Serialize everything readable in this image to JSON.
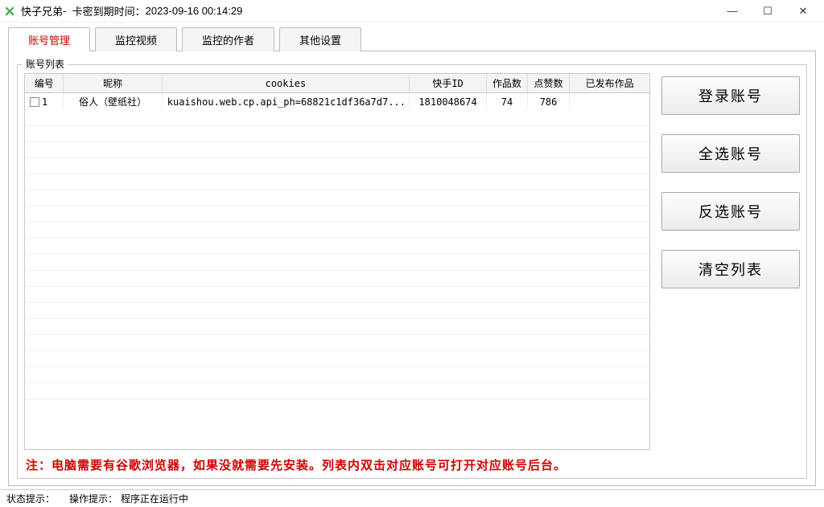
{
  "title": {
    "app_name": "快子兄弟",
    "separator": " - ",
    "expiry_label": "卡密到期时间：",
    "expiry_value": "2023-09-16 00:14:29"
  },
  "window_controls": {
    "minimize": "—",
    "maximize": "☐",
    "close": "✕"
  },
  "tabs": [
    {
      "label": "账号管理",
      "active": true
    },
    {
      "label": "监控视频",
      "active": false
    },
    {
      "label": "监控的作者",
      "active": false
    },
    {
      "label": "其他设置",
      "active": false
    }
  ],
  "panel": {
    "title": "账号列表"
  },
  "table": {
    "headers": {
      "id": "编号",
      "nickname": "昵称",
      "cookies": "cookies",
      "ksid": "快手ID",
      "works": "作品数",
      "likes": "点赞数",
      "published": "已发布作品"
    },
    "rows": [
      {
        "checked": false,
        "id": "1",
        "nickname": "俗人（壁纸社）",
        "cookies": "kuaishou.web.cp.api_ph=68821c1df36a7d7...",
        "ksid": "1810048674",
        "works": "74",
        "likes": "786",
        "published": ""
      }
    ]
  },
  "buttons": {
    "login": "登录账号",
    "select_all": "全选账号",
    "invert": "反选账号",
    "clear": "清空列表"
  },
  "note": "注：电脑需要有谷歌浏览器，如果没就需要先安装。列表内双击对应账号可打开对应账号后台。",
  "status": {
    "state_label": "状态提示：",
    "op_label": "操作提示：",
    "op_value": "程序正在运行中"
  }
}
